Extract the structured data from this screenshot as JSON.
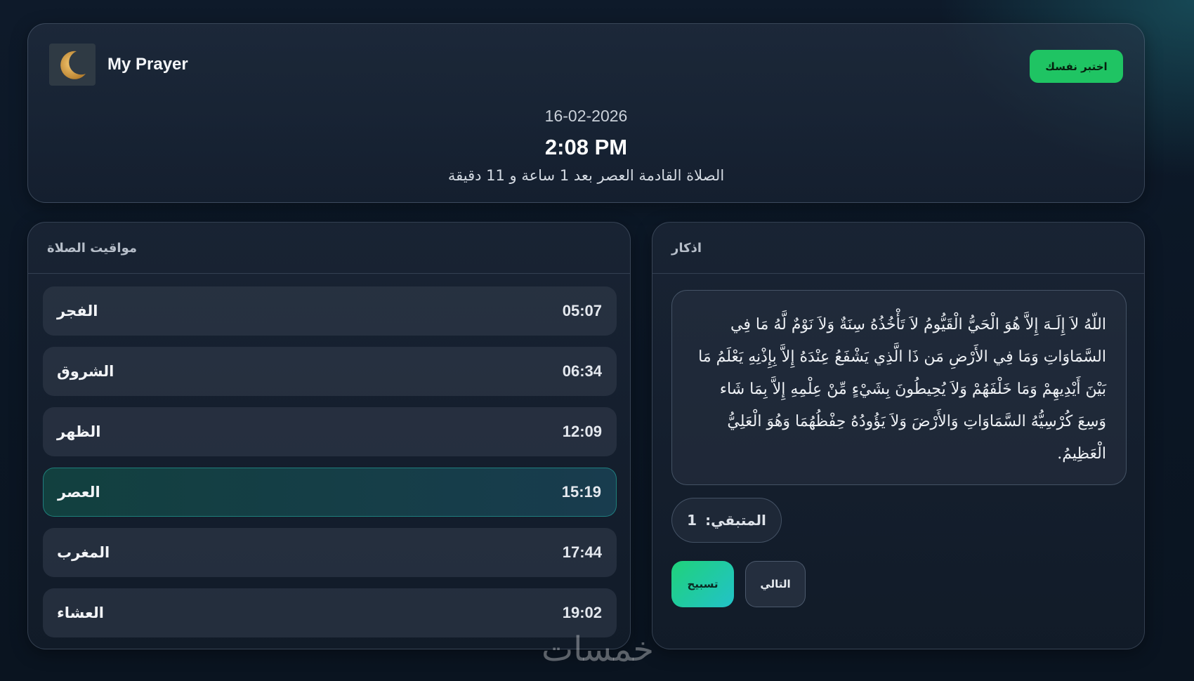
{
  "header": {
    "app_title": "My Prayer",
    "choose_button_label": "اختبر نفسك",
    "date": "16-02-2026",
    "time": "2:08 PM",
    "next_prayer_text": "الصلاة القادمة العصر بعد 1 ساعة و 11 دقيقة",
    "logo_icon": "crescent-moon-icon"
  },
  "prayer_panel": {
    "title": "مواقيت الصلاة",
    "prayers": [
      {
        "name": "الفجر",
        "time": "05:07"
      },
      {
        "name": "الشروق",
        "time": "06:34"
      },
      {
        "name": "الظهر",
        "time": "12:09"
      },
      {
        "name": "العصر",
        "time": "15:19"
      },
      {
        "name": "المغرب",
        "time": "17:44"
      },
      {
        "name": "العشاء",
        "time": "19:02"
      }
    ],
    "active_prayer": "العصر"
  },
  "azkar_panel": {
    "title": "اذكار",
    "dhikr_text": "اللّهُ لاَ إِلَـهَ إِلاَّ هُوَ الْحَيُّ الْقَيُّومُ لاَ تَأْخُذُهُ سِنَةٌ وَلاَ نَوْمٌ لَّهُ مَا فِي السَّمَاوَاتِ وَمَا فِي الأَرْضِ مَن ذَا الَّذِي يَشْفَعُ عِنْدَهُ إِلاَّ بِإِذْنِهِ يَعْلَمُ مَا بَيْنَ أَيْدِيهِمْ وَمَا خَلْفَهُمْ وَلاَ يُحِيطُونَ بِشَيْءٍ مِّنْ عِلْمِهِ إِلاَّ بِمَا شَاء وَسِعَ كُرْسِيُّهُ السَّمَاوَاتِ وَالأَرْضَ وَلاَ يَؤُودُهُ حِفْظُهُمَا وَهُوَ الْعَلِيُّ الْعَظِيمُ.",
    "remaining_label": "المتبقي:",
    "remaining_count": "1",
    "tasbih_button_label": "تسبيح",
    "next_button_label": "التالي"
  },
  "watermark": "خمسات",
  "colors": {
    "accent_green": "#1fc463",
    "active_border": "#28b4aa"
  }
}
